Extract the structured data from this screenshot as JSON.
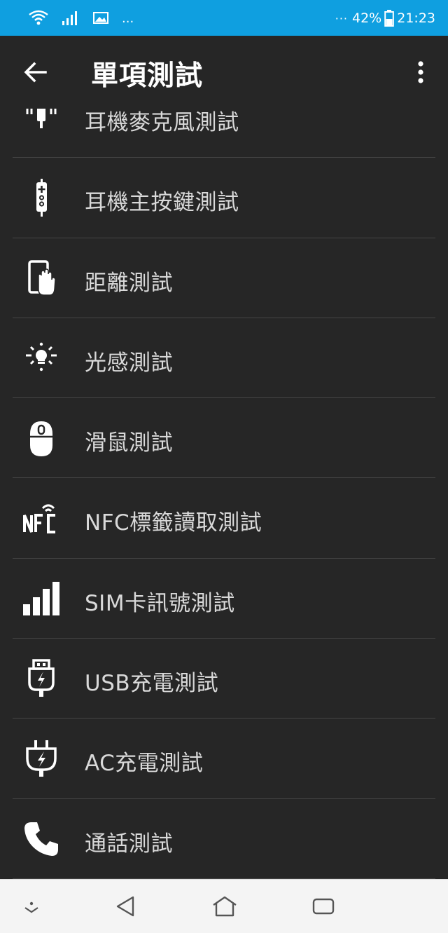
{
  "status_bar": {
    "more": "...",
    "overflow": "···",
    "battery": "42%",
    "time": "21:23"
  },
  "app_bar": {
    "title": "單項測試"
  },
  "tests": [
    {
      "label": "耳機麥克風測試",
      "icon": "headset-mic-icon"
    },
    {
      "label": "耳機主按鍵測試",
      "icon": "headset-button-icon"
    },
    {
      "label": "距離測試",
      "icon": "proximity-icon"
    },
    {
      "label": "光感測試",
      "icon": "light-sensor-icon"
    },
    {
      "label": "滑鼠測試",
      "icon": "mouse-icon"
    },
    {
      "label": "NFC標籤讀取測試",
      "icon": "nfc-icon"
    },
    {
      "label": "SIM卡訊號測試",
      "icon": "signal-bars-icon"
    },
    {
      "label": "USB充電測試",
      "icon": "usb-charge-icon"
    },
    {
      "label": "AC充電測試",
      "icon": "ac-plug-icon"
    },
    {
      "label": "通話測試",
      "icon": "phone-icon"
    }
  ],
  "colors": {
    "status_bar": "#0f9fe0",
    "background": "#262626",
    "text": "#d9d9d9",
    "divider": "#454545",
    "nav_bar": "#f4f4f4"
  }
}
